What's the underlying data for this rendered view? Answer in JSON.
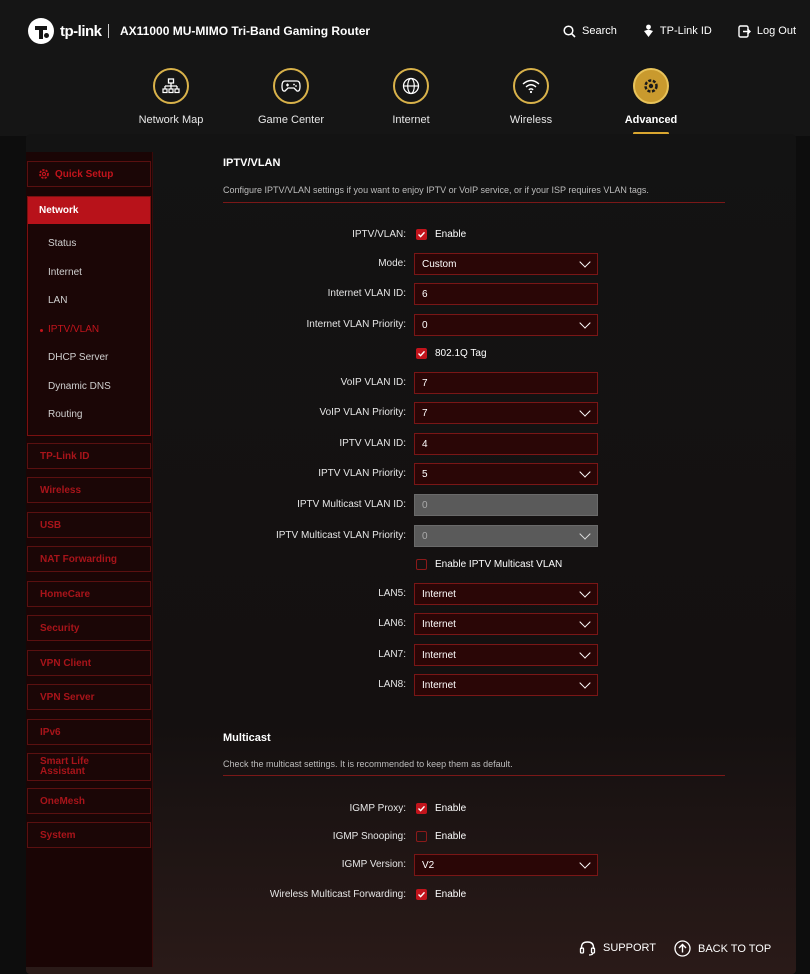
{
  "header": {
    "brand": "tp-link",
    "model": "AX11000 MU-MIMO Tri-Band Gaming Router",
    "links": [
      {
        "label": "Search",
        "icon": "search-icon"
      },
      {
        "label": "TP-Link ID",
        "icon": "user-icon"
      },
      {
        "label": "Log Out",
        "icon": "logout-icon"
      }
    ]
  },
  "nav": [
    {
      "label": "Network Map",
      "icon": "network-map-icon"
    },
    {
      "label": "Game Center",
      "icon": "gamepad-icon"
    },
    {
      "label": "Internet",
      "icon": "globe-icon"
    },
    {
      "label": "Wireless",
      "icon": "wifi-icon"
    },
    {
      "label": "Advanced",
      "icon": "gear-icon",
      "active": true
    }
  ],
  "sidebar": {
    "quick_setup": "Quick Setup",
    "network": {
      "label": "Network",
      "items": [
        "Status",
        "Internet",
        "LAN",
        "IPTV/VLAN",
        "DHCP Server",
        "Dynamic DNS",
        "Routing"
      ],
      "active": "IPTV/VLAN"
    },
    "sections": [
      "TP-Link ID",
      "Wireless",
      "USB",
      "NAT Forwarding",
      "HomeCare",
      "Security",
      "VPN Client",
      "VPN Server",
      "IPv6",
      "Smart Life Assistant",
      "OneMesh",
      "System"
    ]
  },
  "iptv": {
    "title": "IPTV/VLAN",
    "description": "Configure IPTV/VLAN settings if you want to enjoy IPTV or VoIP service, or if your ISP requires VLAN tags.",
    "iptv_vlan_label": "IPTV/VLAN:",
    "enable": "Enable",
    "mode_label": "Mode:",
    "mode_value": "Custom",
    "internet_vlan_id_label": "Internet VLAN ID:",
    "internet_vlan_id": "6",
    "internet_vlan_priority_label": "Internet VLAN Priority:",
    "internet_vlan_priority": "0",
    "tag_label": "802.1Q Tag",
    "voip_vlan_id_label": "VoIP VLAN ID:",
    "voip_vlan_id": "7",
    "voip_vlan_priority_label": "VoIP VLAN Priority:",
    "voip_vlan_priority": "7",
    "iptv_vlan_id_label": "IPTV VLAN ID:",
    "iptv_vlan_id": "4",
    "iptv_vlan_priority_label": "IPTV VLAN Priority:",
    "iptv_vlan_priority": "5",
    "iptv_multicast_vlan_id_label": "IPTV Multicast VLAN ID:",
    "iptv_multicast_vlan_id": "0",
    "iptv_multicast_vlan_priority_label": "IPTV Multicast VLAN Priority:",
    "iptv_multicast_vlan_priority": "0",
    "enable_multicast_vlan": "Enable IPTV Multicast VLAN",
    "lan5_label": "LAN5:",
    "lan5": "Internet",
    "lan6_label": "LAN6:",
    "lan6": "Internet",
    "lan7_label": "LAN7:",
    "lan7": "Internet",
    "lan8_label": "LAN8:",
    "lan8": "Internet"
  },
  "multicast": {
    "title": "Multicast",
    "description": "Check the multicast settings. It is recommended to keep them as default.",
    "igmp_proxy_label": "IGMP Proxy:",
    "igmp_snooping_label": "IGMP Snooping:",
    "igmp_version_label": "IGMP Version:",
    "igmp_version": "V2",
    "wireless_forwarding_label": "Wireless Multicast Forwarding:",
    "enable": "Enable"
  },
  "footer": {
    "support": "SUPPORT",
    "back_to_top": "BACK TO TOP"
  },
  "colors": {
    "accent": "#c2141c",
    "gold": "#d9a630"
  }
}
